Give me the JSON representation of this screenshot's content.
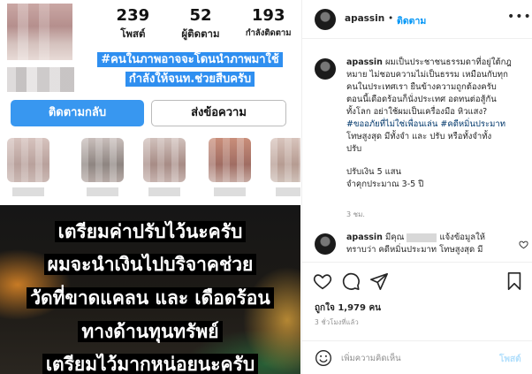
{
  "profile": {
    "stats": [
      {
        "num": "239",
        "label": "โพสต์"
      },
      {
        "num": "52",
        "label": "ผู้ติดตาม"
      },
      {
        "num": "193",
        "label": "กำลังติดตาม"
      }
    ],
    "banner_lines": [
      "#คนในภาพอาจจะโดนนำภาพมาใช้",
      "กำลังให้จนท.ช่วยสืบครับ"
    ],
    "follow_back_label": "ติดตามกลับ",
    "message_label": "ส่งข้อความ"
  },
  "overlay_lines": [
    "เตรียมค่าปรับไว้นะครับ",
    "ผมจะนำเงินไปบริจาคช่วย",
    "วัดที่ขาดแคลน และ เดือดร้อน",
    "ทางด้านทุนทรัพย์",
    "เตรียมไว้มากหน่อยนะครับ"
  ],
  "post": {
    "username": "apassin",
    "separator": "•",
    "follow_label": "ติดตาม",
    "caption_lines": [
      "ผมเป็นประชาชนธรรมดาที่อยู่ใต้กฎ",
      "หมาย ไม่ชอบความไม่เป็นธรรม เหมือนกับทุก",
      "คนในประเทศเรา ยืนข้างความถูกต้องครับ",
      "ตอนนี้เดือดร้อนก็นั่งประเทศ อดทนต่อสู้กัน",
      "ทั้งโลก อย่าใช้ผมเป็นเครื่องมือ หิวแสง?"
    ],
    "hashtag_lines": [
      "#ขออภัยที่ไม่ใช่เพื่อนเล่น #คดีหมิ่นประมาท"
    ],
    "penalty_lines": [
      "โทษสูงสุด มีทั้งจำ และ ปรับ หรือทั้งจำทั้ง",
      "ปรับ"
    ],
    "fine_lines": [
      "ปรับเงิน 5 แสน",
      "จำคุกประมาณ 3-5 ปี"
    ],
    "caption_time": "3 ชม.",
    "comment": {
      "username": "apassin",
      "text_before": "มีคุณ",
      "text_after": "แจ้งข้อมูลให้",
      "text_line2": "ทราบว่า คดีหมิ่นประมาท โทษสูงสุด มี"
    },
    "likes_label": "ถูกใจ",
    "likes_count": "1,979",
    "likes_unit": "คน",
    "post_time": "3 ชั่วโมงที่แล้ว",
    "comment_placeholder": "เพิ่มความคิดเห็น",
    "post_button_label": "โพสต์"
  },
  "colors": {
    "accent_blue": "#3897f0",
    "link_blue": "#0095f6",
    "hashtag": "#00376b",
    "muted": "#8e8e8e",
    "post_disabled": "#b2dffc"
  },
  "icons": [
    "heart-icon",
    "comment-icon",
    "share-icon",
    "bookmark-icon",
    "more-icon",
    "emoji-icon"
  ]
}
